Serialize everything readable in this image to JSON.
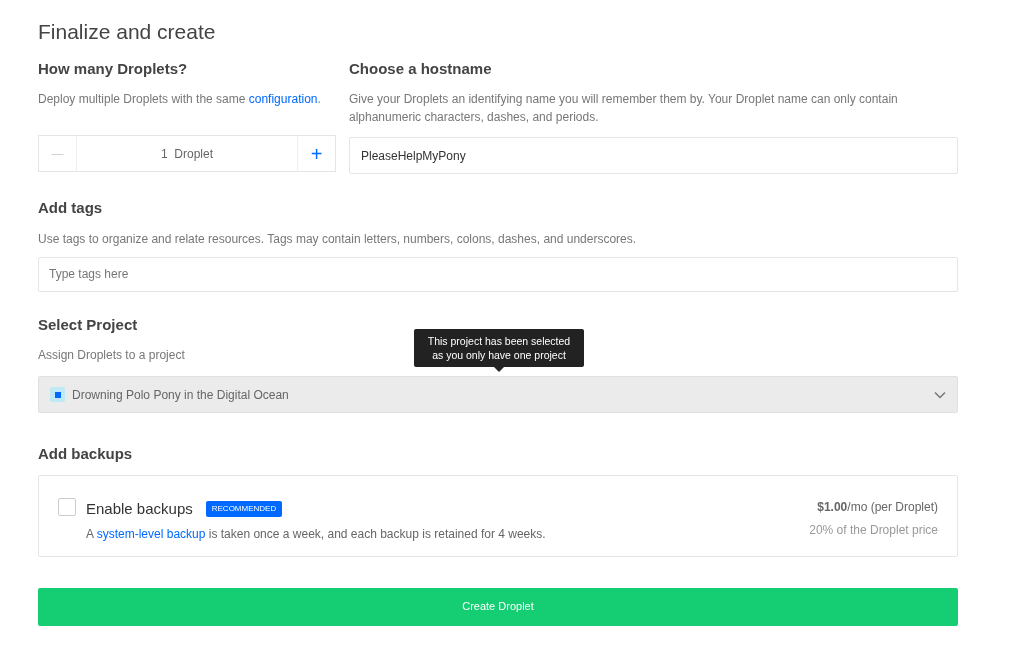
{
  "page_title": "Finalize and create",
  "droplets": {
    "heading": "How many Droplets?",
    "description": {
      "before": "Deploy multiple Droplets with the same ",
      "link": "configuration",
      "after": "."
    },
    "decrement": "—",
    "count": "1  Droplet",
    "increment": "+"
  },
  "hostname": {
    "heading": "Choose a hostname",
    "description": "Give your Droplets an identifying name you will remember them by. Your Droplet name can only contain alphanumeric characters, dashes, and periods.",
    "value": "PleaseHelpMyPony"
  },
  "tags": {
    "heading": "Add tags",
    "description": "Use tags to organize and relate resources. Tags may contain letters, numbers, colons, dashes, and underscores.",
    "placeholder": "Type tags here"
  },
  "project": {
    "heading": "Select Project",
    "description": "Assign Droplets to a project",
    "selected": "Drowning Polo Pony in the Digital Ocean",
    "tooltip": "This project has been selected as you only have one project"
  },
  "backups": {
    "heading": "Add backups",
    "checked": false,
    "label": "Enable backups",
    "badge": "RECOMMENDED",
    "description": {
      "before": "A ",
      "link": "system-level backup",
      "after": " is taken once a week, and each backup is retained for 4 weeks."
    },
    "price": "**$1.00**/mo (per Droplet)",
    "price_note": "20% of the Droplet price"
  },
  "create_button": "Create Droplet"
}
